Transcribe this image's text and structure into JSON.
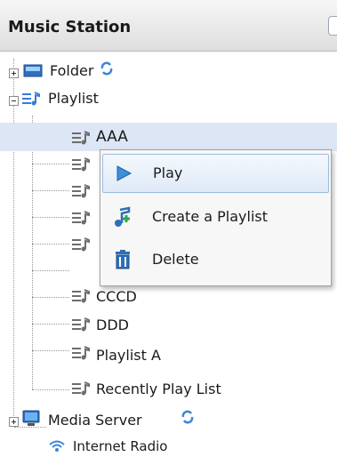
{
  "panel": {
    "title": "Music Station"
  },
  "tree": {
    "folder": {
      "label": "Folder"
    },
    "playlist": {
      "label": "Playlist"
    },
    "playlists": [
      {
        "label": "AAA"
      },
      {
        "label": ""
      },
      {
        "label": ""
      },
      {
        "label": ""
      },
      {
        "label": ""
      },
      {
        "label": "CCCD"
      },
      {
        "label": "DDD"
      },
      {
        "label": "Playlist A"
      },
      {
        "label": "Recently Play List"
      }
    ],
    "media_server": {
      "label": "Media Server"
    },
    "internet_radio": {
      "label": "Internet Radio"
    }
  },
  "context_menu": {
    "items": [
      {
        "label": "Play",
        "icon": "play-icon"
      },
      {
        "label": "Create a Playlist",
        "icon": "add-music-icon"
      },
      {
        "label": "Delete",
        "icon": "trash-icon"
      }
    ]
  },
  "colors": {
    "selection_bg": "#dce6f4",
    "menu_highlight_border": "#9bbbe0",
    "refresh_icon": "#3a86d8",
    "icon_blue": "#2d6fb8"
  }
}
